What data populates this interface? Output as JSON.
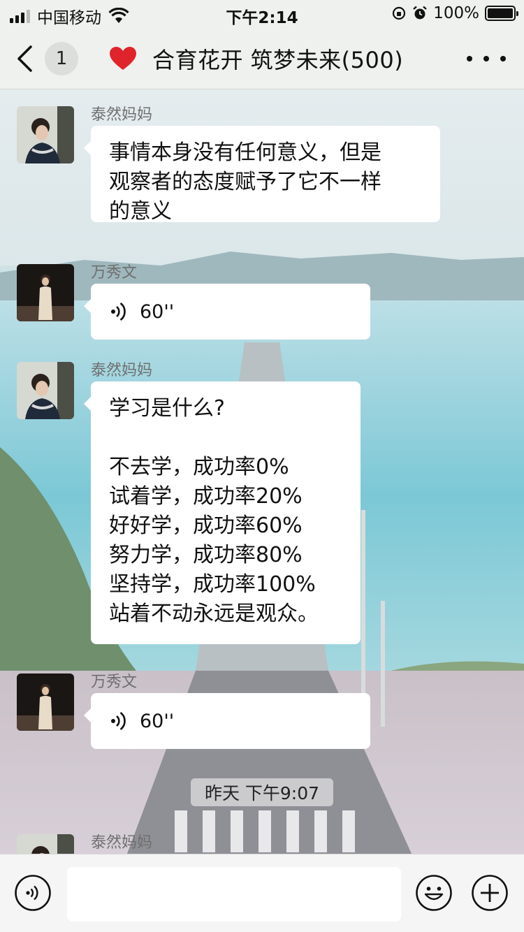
{
  "status_bar": {
    "carrier": "中国移动",
    "time": "下午2:14",
    "battery": "100%"
  },
  "nav": {
    "unread_count": "1",
    "title": "合育花开 筑梦未来(500)",
    "icons": {
      "back": "chevron-left-icon",
      "title_emoji": "heart-icon",
      "more": "more-dots-icon"
    }
  },
  "messages": [
    {
      "sender": "泰然妈妈",
      "type": "text",
      "text": "事情本身没有任何意义，但是\n观察者的态度赋予了它不一样\n的意义"
    },
    {
      "sender": "万秀文",
      "type": "voice",
      "duration": "60''"
    },
    {
      "sender": "泰然妈妈",
      "type": "text",
      "text": "学习是什么?\n\n不去学，成功率0%\n试着学，成功率20%\n好好学，成功率60%\n努力学，成功率80%\n坚持学，成功率100%\n站着不动永远是观众。"
    },
    {
      "sender": "万秀文",
      "type": "voice",
      "duration": "60''"
    },
    {
      "sender": "泰然妈妈",
      "type": "text",
      "text": ""
    }
  ],
  "timestamp": "昨天 下午9:07",
  "input_bar": {
    "placeholder": "",
    "icons": [
      "voice-toggle-icon",
      "emoji-icon",
      "plus-icon"
    ]
  },
  "colors": {
    "bar_bg": "#eef1ee",
    "bubble_bg": "#ffffff",
    "heart": "#e0242b"
  }
}
